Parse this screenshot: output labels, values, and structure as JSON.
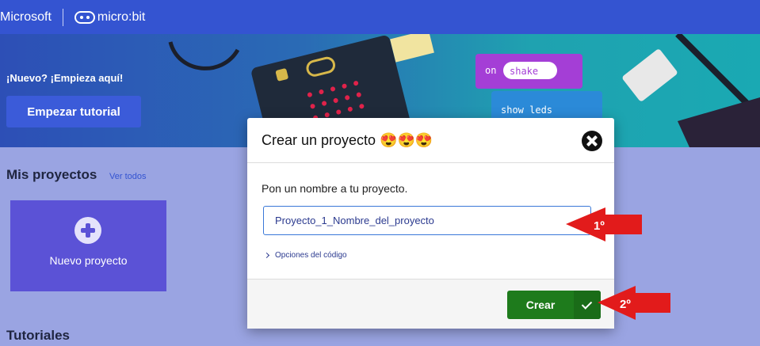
{
  "topbar": {
    "brand_microsoft": "Microsoft",
    "brand_microbit": "micro:bit"
  },
  "hero": {
    "welcome_text": "¡Nuevo? ¡Empieza aquí!",
    "start_tutorial": "Empezar tutorial",
    "block_on": "on",
    "block_shake": "shake",
    "block_show_leds": "show leds"
  },
  "projects": {
    "title": "Mis proyectos",
    "see_all": "Ver todos",
    "new_project": "Nuevo proyecto"
  },
  "tutorials": {
    "title": "Tutoriales"
  },
  "modal": {
    "title": "Crear un proyecto 😍😍😍",
    "prompt": "Pon un nombre a tu proyecto.",
    "project_name_value": "Proyecto_1_Nombre_del_proyecto",
    "code_options": "Opciones del código",
    "create": "Crear"
  },
  "annotations": {
    "step1": "1º",
    "step2": "2º"
  },
  "colors": {
    "topbar": "#3454d1",
    "page_bg": "#9aa4e2",
    "new_card": "#5b52d6",
    "create_button": "#1e7b1c",
    "arrow": "#e21b1b"
  }
}
